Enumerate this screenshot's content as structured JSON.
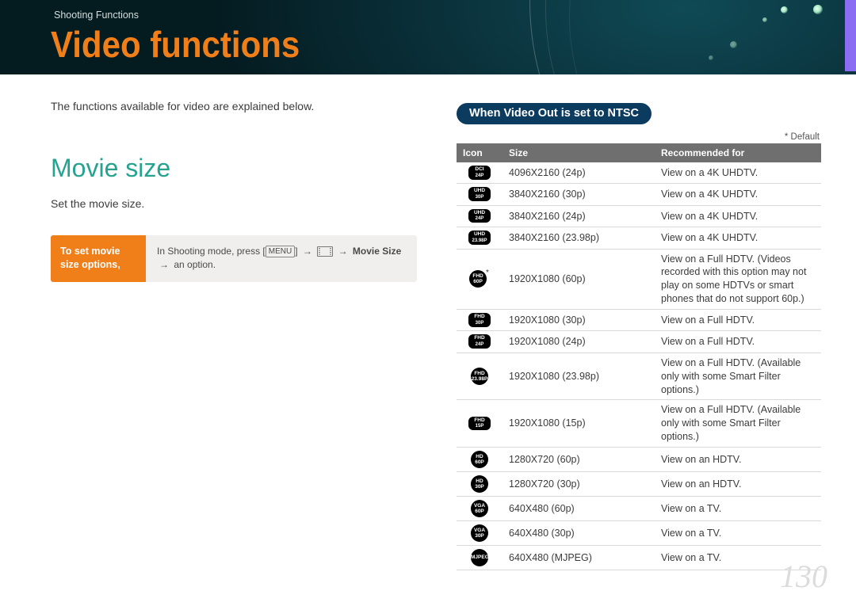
{
  "header": {
    "breadcrumb": "Shooting Functions",
    "title": "Video functions"
  },
  "left": {
    "intro": "The functions available for video are explained below.",
    "section_heading": "Movie size",
    "section_sub": "Set the movie size.",
    "callout_left": "To set movie size options,",
    "callout_right_prefix": "In Shooting mode, press [",
    "callout_menu": "MENU",
    "callout_right_mid": "] ",
    "callout_bold": "Movie Size",
    "callout_right_suffix": " an option."
  },
  "right": {
    "pill": "When Video Out is set to NTSC",
    "default_note": "* Default",
    "columns": {
      "icon": "Icon",
      "size": "Size",
      "rec": "Recommended for"
    },
    "rows": [
      {
        "icon_top": "DCI",
        "icon_bot": "24P",
        "size": "4096X2160 (24p)",
        "rec": "View on a 4K UHDTV.",
        "star": false
      },
      {
        "icon_top": "UHD",
        "icon_bot": "30P",
        "size": "3840X2160 (30p)",
        "rec": "View on a 4K UHDTV.",
        "star": false
      },
      {
        "icon_top": "UHD",
        "icon_bot": "24P",
        "size": "3840X2160 (24p)",
        "rec": "View on a 4K UHDTV.",
        "star": false
      },
      {
        "icon_top": "UHD",
        "icon_bot": "23.98P",
        "size": "3840X2160 (23.98p)",
        "rec": "View on a 4K UHDTV.",
        "star": false
      },
      {
        "icon_top": "FHD",
        "icon_bot": "60P",
        "size": "1920X1080 (60p)",
        "rec": "View on a Full HDTV. (Videos recorded with this option may not play on some HDTVs or smart phones that do not support 60p.)",
        "star": true,
        "round": true
      },
      {
        "icon_top": "FHD",
        "icon_bot": "30P",
        "size": "1920X1080 (30p)",
        "rec": "View on a Full HDTV.",
        "star": false
      },
      {
        "icon_top": "FHD",
        "icon_bot": "24P",
        "size": "1920X1080 (24p)",
        "rec": "View on a Full HDTV.",
        "star": false
      },
      {
        "icon_top": "FHD",
        "icon_bot": "23.98P",
        "size": "1920X1080 (23.98p)",
        "rec": "View on a Full HDTV. (Available only with some Smart Filter options.)",
        "star": false,
        "round": true
      },
      {
        "icon_top": "FHD",
        "icon_bot": "15P",
        "size": "1920X1080 (15p)",
        "rec": "View on a Full HDTV. (Available only with some Smart Filter options.)",
        "star": false
      },
      {
        "icon_top": "HD",
        "icon_bot": "60P",
        "size": "1280X720 (60p)",
        "rec": "View on an HDTV.",
        "star": false,
        "round": true
      },
      {
        "icon_top": "HD",
        "icon_bot": "30P",
        "size": "1280X720 (30p)",
        "rec": "View on an HDTV.",
        "star": false,
        "round": true
      },
      {
        "icon_top": "VGA",
        "icon_bot": "60P",
        "size": "640X480 (60p)",
        "rec": "View on a TV.",
        "star": false,
        "round": true
      },
      {
        "icon_top": "VGA",
        "icon_bot": "30P",
        "size": "640X480 (30p)",
        "rec": "View on a TV.",
        "star": false,
        "round": true
      },
      {
        "icon_top": "MJPEG",
        "icon_bot": "",
        "size": "640X480 (MJPEG)",
        "rec": "View on a TV.",
        "star": false,
        "round": true
      }
    ]
  },
  "page_number": "130"
}
